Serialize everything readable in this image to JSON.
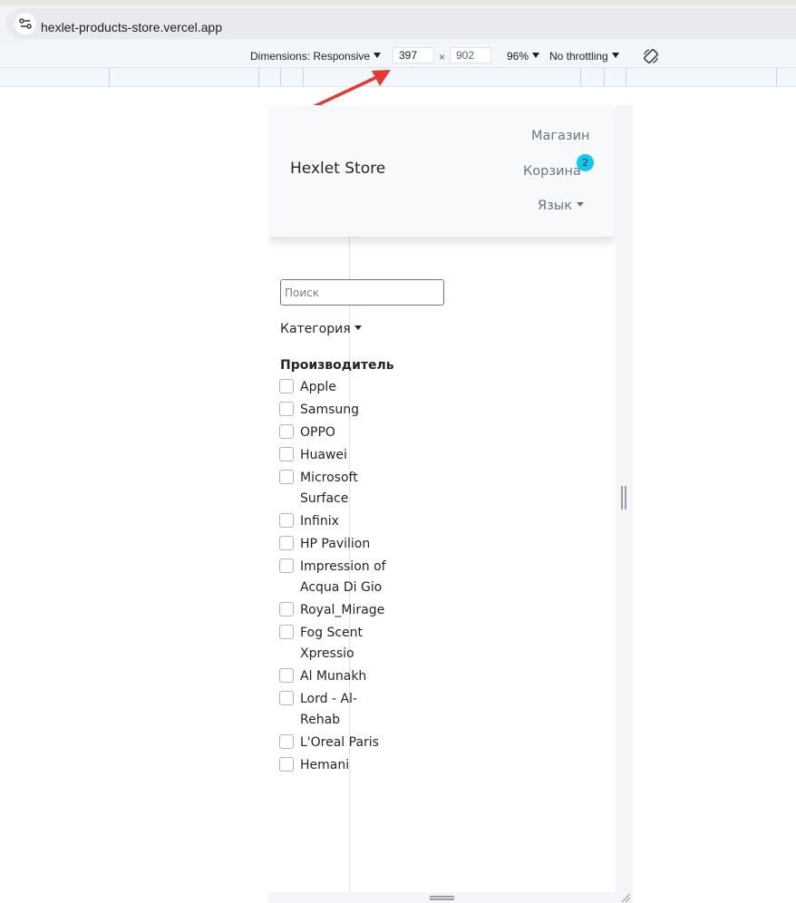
{
  "browser": {
    "url": "hexlet-products-store.vercel.app"
  },
  "devtools": {
    "dimensions_label": "Dimensions: Responsive",
    "width_value": "397",
    "times": "×",
    "height_value": "902",
    "zoom": "96%",
    "throttling": "No throttling"
  },
  "navbar": {
    "brand": "Hexlet Store",
    "shop": "Магазин",
    "cart": "Корзина",
    "cart_count": "2",
    "language": "Язык"
  },
  "filters": {
    "search_placeholder": "Поиск",
    "category": "Категория",
    "manufacturer_heading": "Производитель",
    "manufacturers": [
      "Apple",
      "Samsung",
      "OPPO",
      "Huawei",
      "Microsoft Surface",
      "Infinix",
      "HP Pavilion",
      "Impression of Acqua Di Gio",
      "Royal_Mirage",
      "Fog Scent Xpressio",
      "Al Munakh",
      "Lord - Al-Rehab",
      "L'Oreal Paris",
      "Hemani"
    ]
  },
  "colors": {
    "badge": "#0dcaf0",
    "arrow": "#e53935"
  }
}
